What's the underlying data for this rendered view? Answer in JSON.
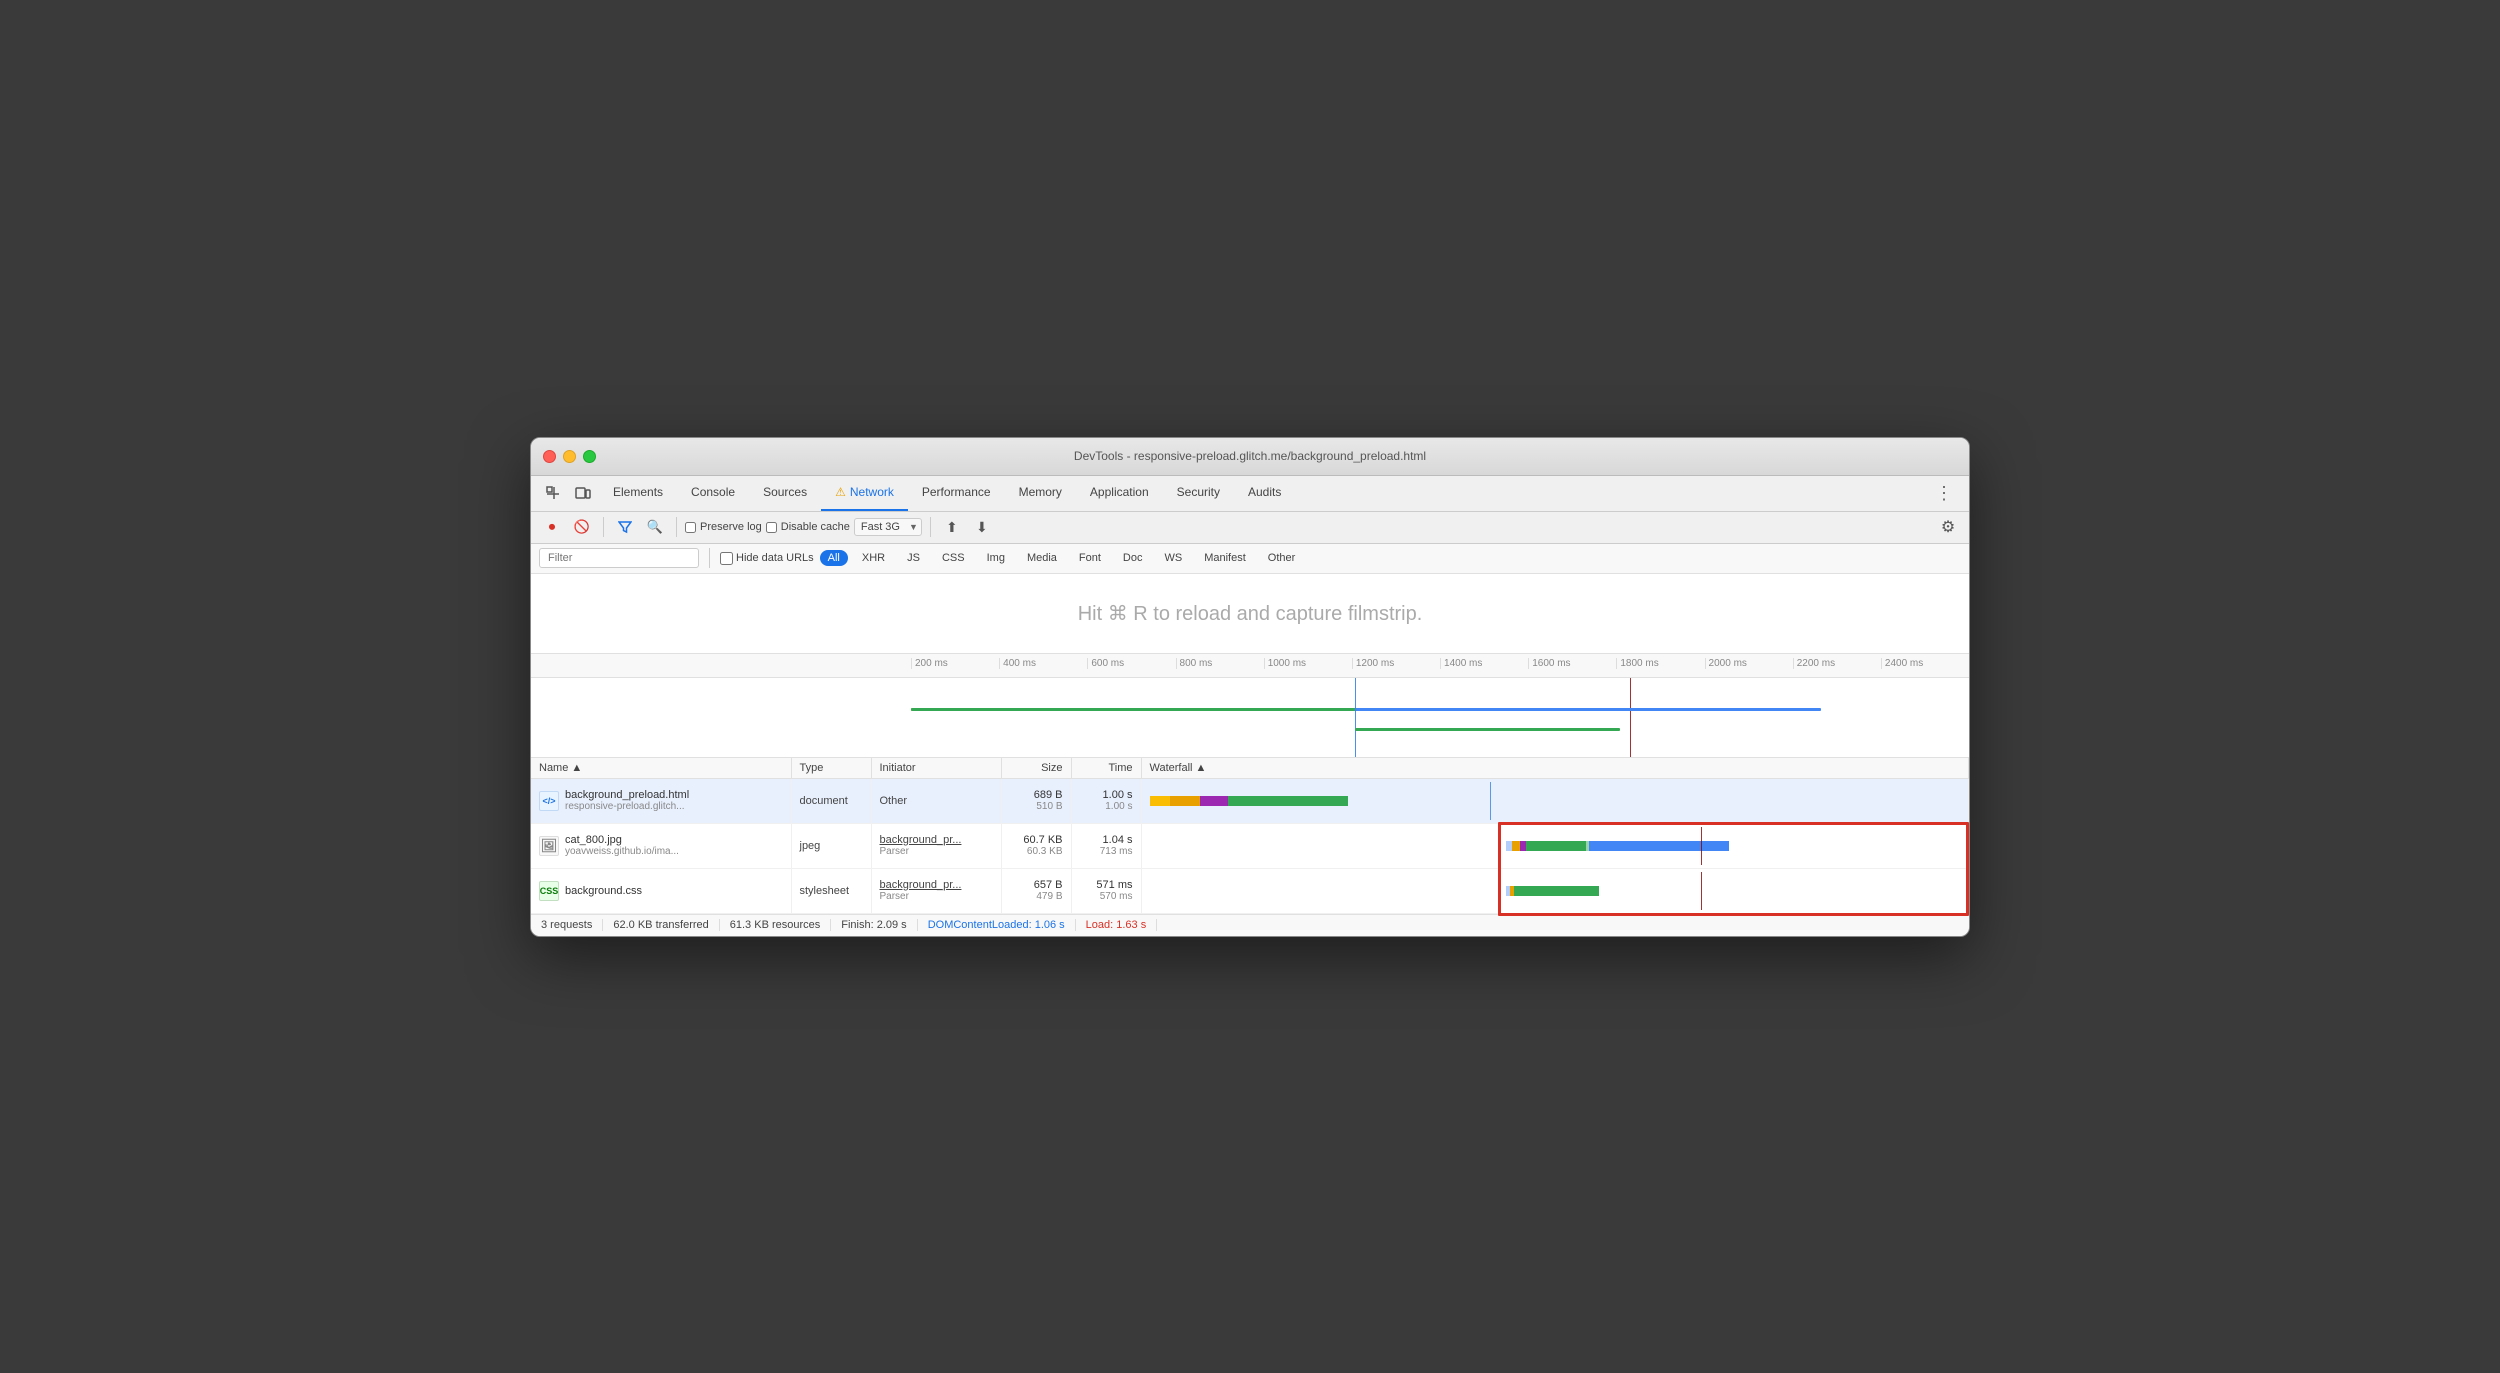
{
  "window": {
    "title": "DevTools - responsive-preload.glitch.me/background_preload.html"
  },
  "tabs": [
    {
      "label": "Elements",
      "active": false
    },
    {
      "label": "Console",
      "active": false
    },
    {
      "label": "Sources",
      "active": false
    },
    {
      "label": "Network",
      "active": true,
      "warning": true
    },
    {
      "label": "Performance",
      "active": false
    },
    {
      "label": "Memory",
      "active": false
    },
    {
      "label": "Application",
      "active": false
    },
    {
      "label": "Security",
      "active": false
    },
    {
      "label": "Audits",
      "active": false
    }
  ],
  "toolbar": {
    "preserve_log": "Preserve log",
    "disable_cache": "Disable cache",
    "throttle_value": "Fast 3G"
  },
  "filter": {
    "placeholder": "Filter",
    "hide_data_urls": "Hide data URLs",
    "types": [
      "All",
      "XHR",
      "JS",
      "CSS",
      "Img",
      "Media",
      "Font",
      "Doc",
      "WS",
      "Manifest",
      "Other"
    ]
  },
  "filmstrip": {
    "hint": "Hit ⌘ R to reload and capture filmstrip."
  },
  "ruler": {
    "ticks": [
      "200 ms",
      "400 ms",
      "600 ms",
      "800 ms",
      "1000 ms",
      "1200 ms",
      "1400 ms",
      "1600 ms",
      "1800 ms",
      "2000 ms",
      "2200 ms",
      "2400 ms"
    ]
  },
  "table": {
    "columns": [
      "Name",
      "Type",
      "Initiator",
      "Size",
      "Time",
      "Waterfall"
    ],
    "rows": [
      {
        "name_primary": "background_preload.html",
        "name_secondary": "responsive-preload.glitch...",
        "type": "document",
        "initiator_primary": "Other",
        "size_primary": "689 B",
        "size_secondary": "510 B",
        "time_primary": "1.00 s",
        "time_secondary": "1.00 s",
        "icon_type": "html",
        "icon_text": "</>",
        "selected": true
      },
      {
        "name_primary": "cat_800.jpg",
        "name_secondary": "yoavweiss.github.io/ima...",
        "type": "jpeg",
        "initiator_primary": "background_pr...",
        "initiator_secondary": "Parser",
        "size_primary": "60.7 KB",
        "size_secondary": "60.3 KB",
        "time_primary": "1.04 s",
        "time_secondary": "713 ms",
        "icon_type": "img",
        "icon_text": "🖼",
        "selected": false
      },
      {
        "name_primary": "background.css",
        "name_secondary": "",
        "type": "stylesheet",
        "initiator_primary": "background_pr...",
        "initiator_secondary": "Parser",
        "size_primary": "657 B",
        "size_secondary": "479 B",
        "time_primary": "571 ms",
        "time_secondary": "570 ms",
        "icon_type": "css",
        "icon_text": "CSS",
        "selected": false
      }
    ]
  },
  "status": {
    "requests": "3 requests",
    "transferred": "62.0 KB transferred",
    "resources": "61.3 KB resources",
    "finish": "Finish: 2.09 s",
    "dom_content_loaded": "DOMContentLoaded: 1.06 s",
    "load": "Load: 1.63 s"
  }
}
